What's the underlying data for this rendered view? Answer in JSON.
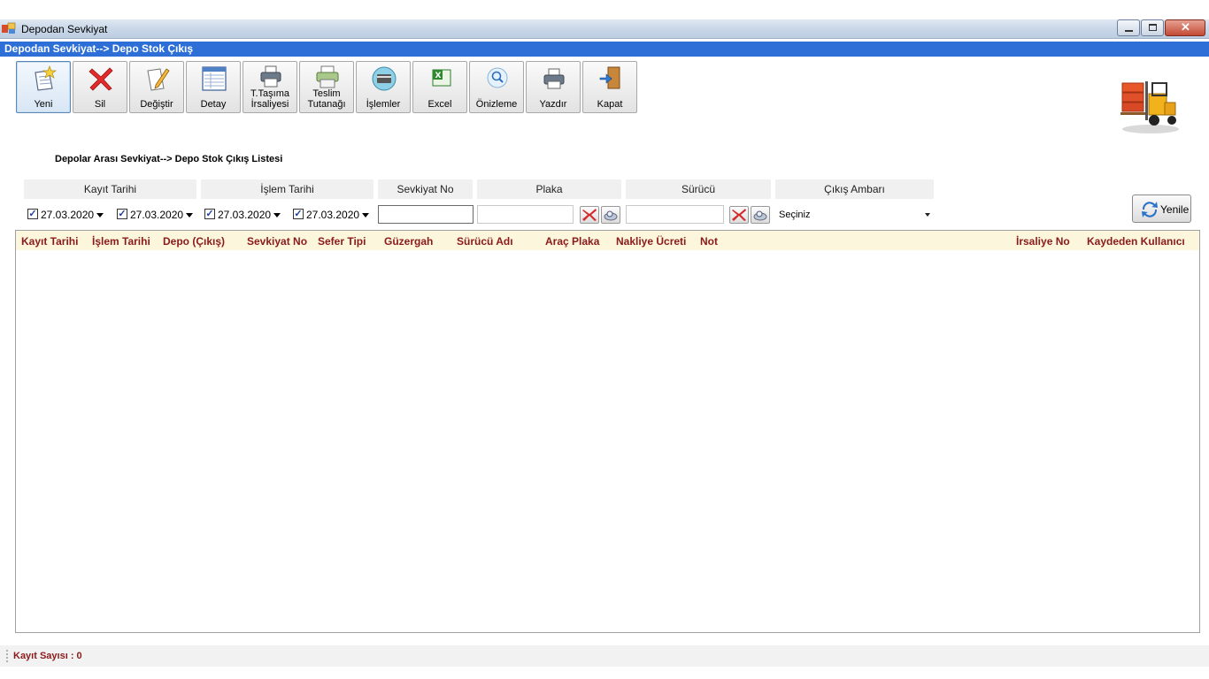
{
  "window": {
    "title": "Depodan Sevkiyat"
  },
  "header": {
    "breadcrumb": "Depodan Sevkiyat--> Depo Stok Çıkış"
  },
  "toolbar": [
    {
      "label": "Yeni",
      "icon": "new-document-star-icon"
    },
    {
      "label": "Sil",
      "icon": "delete-x-icon"
    },
    {
      "label": "Değiştir",
      "icon": "edit-pencil-icon"
    },
    {
      "label": "Detay",
      "icon": "detail-table-icon"
    },
    {
      "label_line1": "T.Taşıma",
      "label_line2": "İrsaliyesi",
      "icon": "printer-icon"
    },
    {
      "label_line1": "Teslim",
      "label_line2": "Tutanağı",
      "icon": "printer-green-icon"
    },
    {
      "label": "İşlemler",
      "icon": "operations-card-icon"
    },
    {
      "label": "Excel",
      "icon": "excel-icon"
    },
    {
      "label": "Önizleme",
      "icon": "preview-magnifier-icon"
    },
    {
      "label": "Yazdır",
      "icon": "printer-icon"
    },
    {
      "label": "Kapat",
      "icon": "exit-door-icon"
    }
  ],
  "list_title": "Depolar Arası Sevkiyat--> Depo Stok Çıkış Listesi",
  "filters": {
    "kayit_tarihi_label": "Kayıt Tarihi",
    "islem_tarihi_label": "İşlem Tarihi",
    "sevkiyat_no_label": "Sevkiyat No",
    "plaka_label": "Plaka",
    "surucu_label": "Sürücü",
    "cikis_ambari_label": "Çıkış Ambarı",
    "kayit_tarihi_from": "27.03.2020",
    "kayit_tarihi_to": "27.03.2020",
    "islem_tarihi_from": "27.03.2020",
    "islem_tarihi_to": "27.03.2020",
    "sevkiyat_no_value": "",
    "plaka_value": "",
    "surucu_value": "",
    "cikis_ambari_value": "Seçiniz",
    "checkbox_mark": "✓"
  },
  "refresh_label": "Yenile",
  "grid": {
    "columns": [
      "Kayıt Tarihi",
      "İşlem Tarihi",
      "Depo (Çıkış)",
      "Sevkiyat No",
      "Sefer Tipi",
      "Güzergah",
      "Sürücü Adı",
      "Araç Plaka",
      "Nakliye Ücreti",
      "Not",
      "İrsaliye No",
      "Kaydeden Kullanıcı"
    ],
    "rows": []
  },
  "status": {
    "text": "Kayıt Sayısı : 0"
  },
  "colors": {
    "accent_blue": "#2d6fd6",
    "header_text": "#8b1a1a",
    "grid_header_bg": "#fbf6dc"
  }
}
